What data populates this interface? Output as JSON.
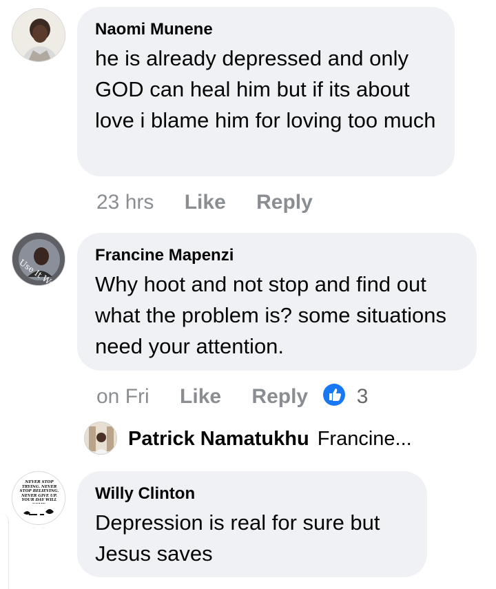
{
  "comments": [
    {
      "author": "Naomi Munene",
      "text": "he is already depressed and only GOD can heal him but if its about love i blame him for loving too much",
      "time": "23 hrs",
      "like_label": "Like",
      "reply_label": "Reply"
    },
    {
      "author": "Francine Mapenzi",
      "text": "Why hoot and not stop and find out what the problem is? some situations need your attention.",
      "time": "on Fri",
      "like_label": "Like",
      "reply_label": "Reply",
      "reaction_count": "3",
      "avatar_text": "Use It Well",
      "reply_preview": {
        "author": "Patrick Namatukhu",
        "snippet": "Francine..."
      }
    },
    {
      "author": "Willy Clinton",
      "text": "Depression is real for sure but Jesus saves",
      "avatar_text": "NEVER STOP TRYING. NEVER STOP BELIEVING. NEVER GIVE UP. YOUR DAY WILL COME."
    }
  ],
  "colors": {
    "bubble": "#eff1f4",
    "meta": "#8a8d91",
    "like_blue": "#1877f2"
  }
}
